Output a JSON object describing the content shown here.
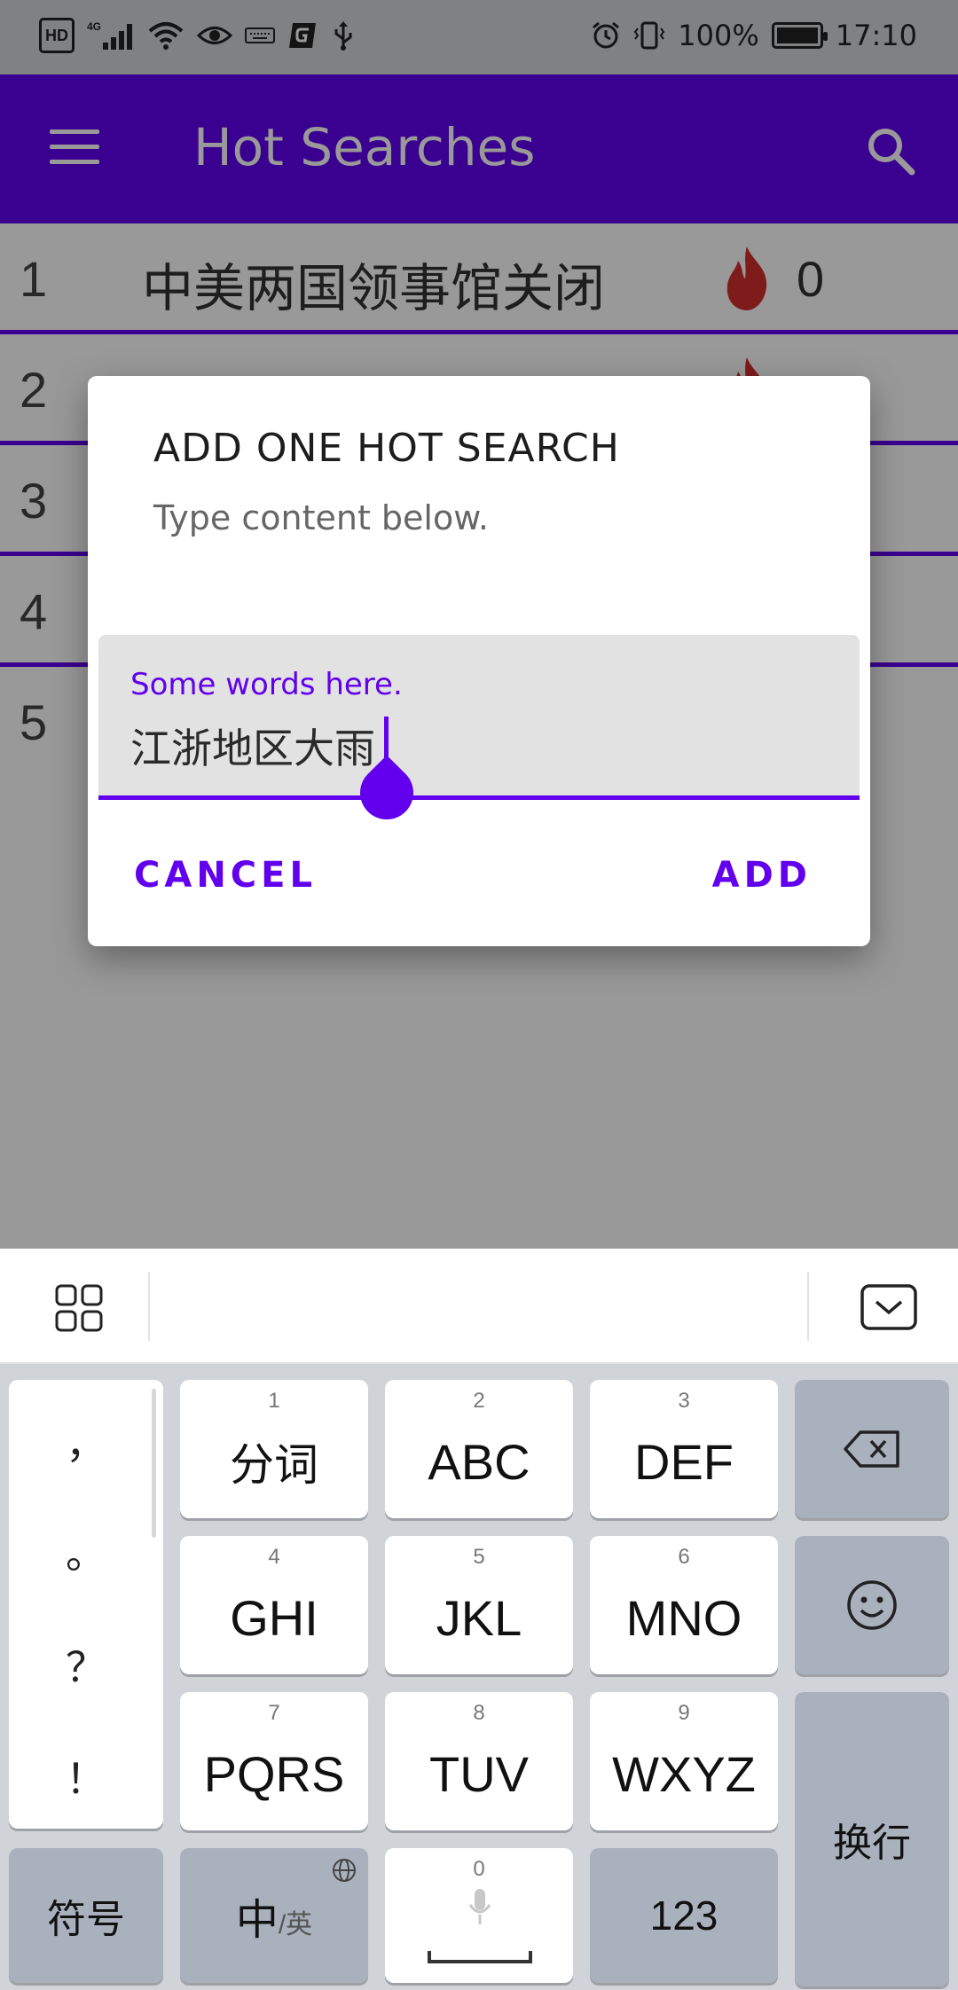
{
  "status_bar": {
    "left_icons": [
      "hd-icon",
      "signal-4g-icon",
      "wifi-icon",
      "eye-icon",
      "keyboard-icon",
      "game-icon",
      "usb-icon"
    ],
    "hd_label": "HD",
    "net_label": "4G",
    "battery": "100%",
    "time": "17:10"
  },
  "app_bar": {
    "title": "Hot Searches"
  },
  "list": [
    {
      "index": "1",
      "text": "中美两国领事馆关闭",
      "count": "0"
    },
    {
      "index": "2",
      "text": "",
      "count": ""
    },
    {
      "index": "3",
      "text": "",
      "count": ""
    },
    {
      "index": "4",
      "text": "",
      "count": ""
    },
    {
      "index": "5",
      "text": "",
      "count": ""
    }
  ],
  "dialog": {
    "title": "ADD ONE HOT SEARCH",
    "message": "Type content below.",
    "field_label": "Some words here.",
    "field_value": "江浙地区大雨",
    "cancel_label": "CANCEL",
    "add_label": "ADD"
  },
  "keyboard": {
    "punctuation": [
      "，",
      "。",
      "？",
      "！"
    ],
    "keys": [
      {
        "num": "1",
        "label": "分词"
      },
      {
        "num": "2",
        "label": "ABC"
      },
      {
        "num": "3",
        "label": "DEF"
      },
      {
        "num": "4",
        "label": "GHI"
      },
      {
        "num": "5",
        "label": "JKL"
      },
      {
        "num": "6",
        "label": "MNO"
      },
      {
        "num": "7",
        "label": "PQRS"
      },
      {
        "num": "8",
        "label": "TUV"
      },
      {
        "num": "9",
        "label": "WXYZ"
      }
    ],
    "symbols_label": "符号",
    "lang_main": "中",
    "lang_alt": "/英",
    "space_num": "0",
    "num_label": "123",
    "enter_label": "换行"
  },
  "colors": {
    "primary": "#6200ee",
    "fire": "#d32f2f"
  }
}
